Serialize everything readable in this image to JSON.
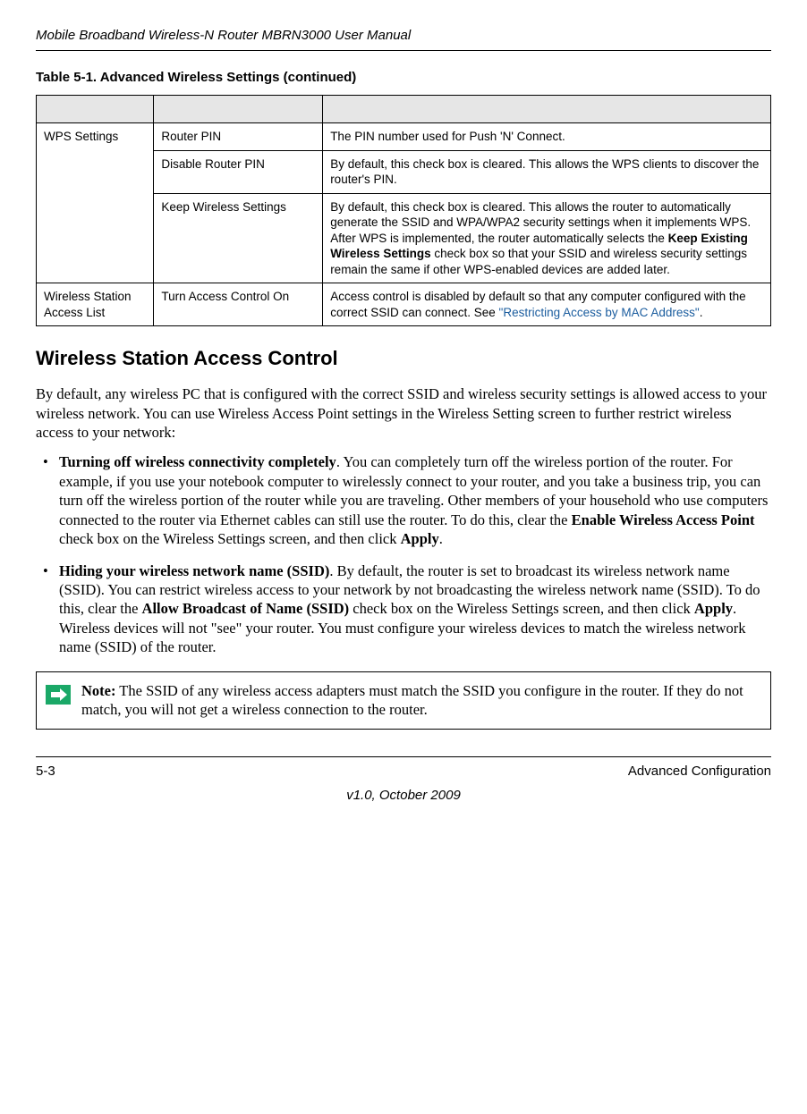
{
  "header": {
    "doc_title": "Mobile Broadband Wireless-N Router MBRN3000 User Manual"
  },
  "table_caption": "Table 5-1.  Advanced Wireless Settings  (continued)",
  "table": {
    "rows": [
      {
        "group": "WPS Settings",
        "items": [
          {
            "setting": "Router PIN",
            "desc": "The PIN number used for Push 'N' Connect."
          },
          {
            "setting": "Disable Router PIN",
            "desc": "By default, this check box is cleared. This allows the WPS clients to discover the router's PIN."
          },
          {
            "setting": "Keep Wireless Settings",
            "desc_pre": "By default, this check box is cleared. This allows the router to automatically generate the SSID and WPA/WPA2 security settings when it implements WPS. After WPS is implemented, the router automatically selects the ",
            "desc_bold": "Keep Existing Wireless Settings",
            "desc_post": " check box so that your SSID and wireless security settings remain the same if other WPS-enabled devices are added later."
          }
        ]
      },
      {
        "group": "Wireless Station Access List",
        "items": [
          {
            "setting": "Turn Access Control On",
            "desc_pre": "Access control is disabled by default so that any computer configured with the correct SSID can connect. See ",
            "link": "\"Restricting Access by MAC Address\"",
            "desc_post": "."
          }
        ]
      }
    ]
  },
  "section_title": "Wireless Station Access Control",
  "intro_para": "By default, any wireless PC that is configured with the correct SSID and wireless security settings is allowed access to your wireless network. You can use Wireless Access Point settings in the Wireless Setting screen to further restrict wireless access to your network:",
  "bullets": [
    {
      "title": "Turning off wireless connectivity completely",
      "body_pre": ".\nYou can completely turn off the wireless portion of the router. For example, if you use your notebook computer to wirelessly connect to your router, and you take a business trip, you can turn off the wireless portion of the router while you are traveling. Other members of your household who use computers connected to the router via Ethernet cables can still use the router. To do this, clear the ",
      "bold1": "Enable Wireless Access Point",
      "mid": " check box on the Wireless Settings screen, and then click ",
      "bold2": "Apply",
      "post": "."
    },
    {
      "title": "Hiding your wireless network name (SSID)",
      "body_pre": ".\nBy default, the router is set to broadcast its wireless network name (SSID). You can restrict wireless access to your network by not broadcasting the wireless network name (SSID). To do this, clear the ",
      "bold1": "Allow Broadcast of Name (SSID)",
      "mid": " check box on the Wireless Settings screen, and then click ",
      "bold2": "Apply",
      "post": ". Wireless devices will not \"see\" your router. You must configure your wireless devices to match the wireless network name (SSID) of the router."
    }
  ],
  "note": {
    "label": "Note:",
    "text": " The SSID of any wireless access adapters must match the SSID you configure in the router. If they do not match, you will not get a wireless connection to the router."
  },
  "footer": {
    "page_num": "5-3",
    "right": "Advanced Configuration",
    "version": "v1.0, October 2009"
  }
}
